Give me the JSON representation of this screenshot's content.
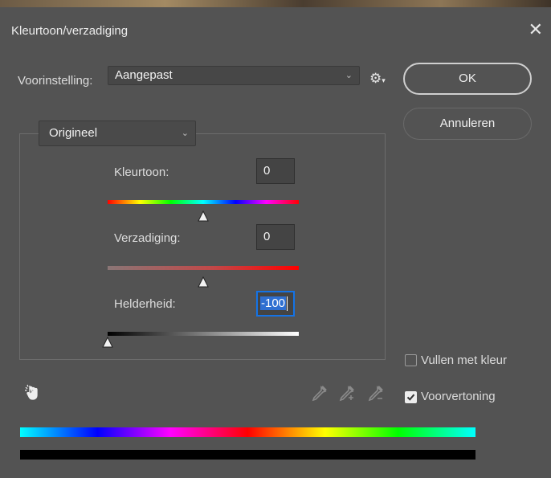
{
  "dialog": {
    "title": "Kleurtoon/verzadiging",
    "close_glyph": "✕"
  },
  "preset": {
    "label": "Voorinstelling:",
    "value": "Aangepast"
  },
  "buttons": {
    "ok": "OK",
    "cancel": "Annuleren"
  },
  "channel": {
    "value": "Origineel"
  },
  "sliders": {
    "hue": {
      "label": "Kleurtoon:",
      "value": "0",
      "min": -180,
      "max": 180
    },
    "saturation": {
      "label": "Verzadiging:",
      "value": "0",
      "min": -100,
      "max": 100
    },
    "lightness": {
      "label": "Helderheid:",
      "value": "-100",
      "min": -100,
      "max": 100
    }
  },
  "options": {
    "colorize": {
      "label": "Vullen met kleur",
      "checked": false
    },
    "preview": {
      "label": "Voorvertoning",
      "checked": true
    }
  },
  "icons": {
    "gear": "gear-icon",
    "hand": "on-image-adjust-icon",
    "eyedropper": "eyedropper-icon",
    "eyedropper_add": "eyedropper-plus-icon",
    "eyedropper_sub": "eyedropper-minus-icon"
  },
  "colors": {
    "accent": "#1473e6",
    "background": "#535353"
  }
}
